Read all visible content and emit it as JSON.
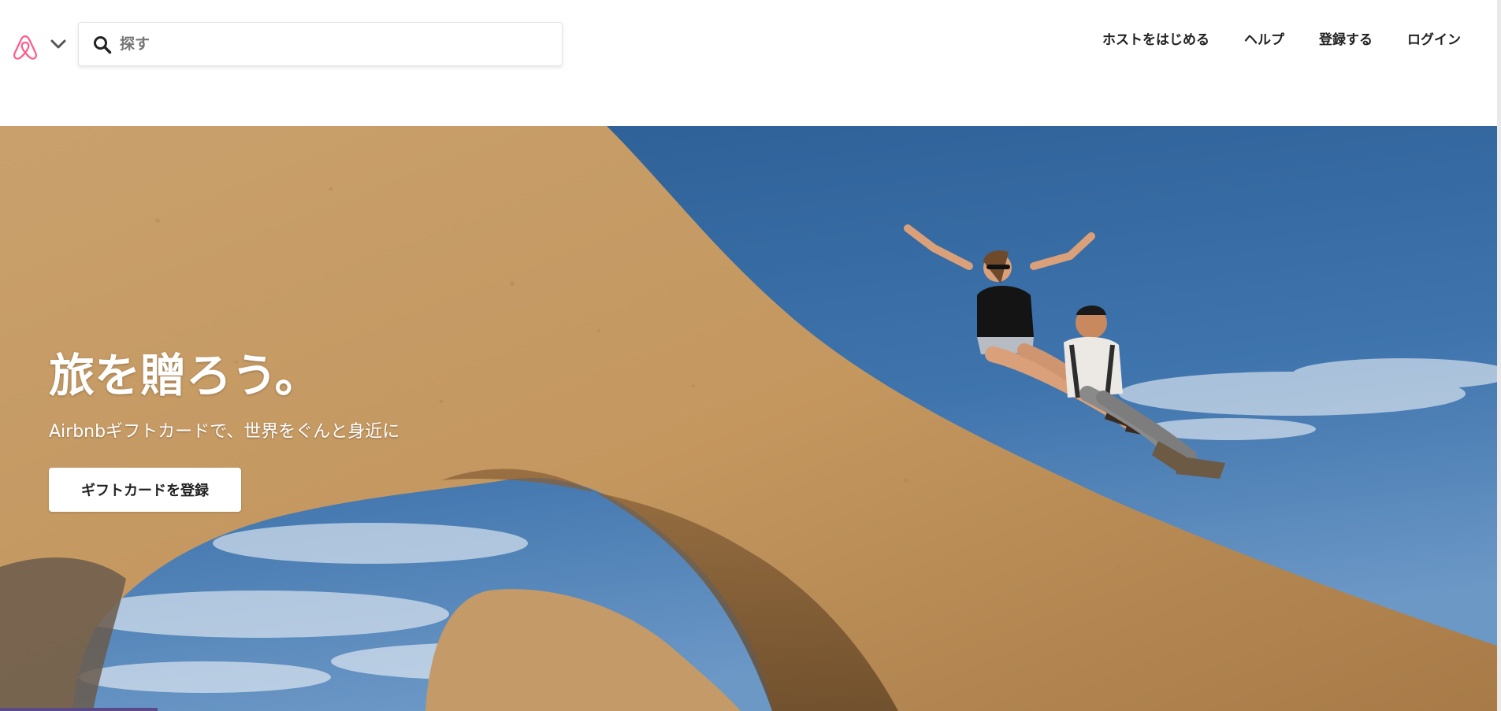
{
  "header": {
    "search": {
      "placeholder": "探す",
      "value": ""
    },
    "nav": [
      {
        "label": "ホストをはじめる"
      },
      {
        "label": "ヘルプ"
      },
      {
        "label": "登録する"
      },
      {
        "label": "ログイン"
      }
    ]
  },
  "hero": {
    "title": "旅を贈ろう。",
    "subtitle": "Airbnbギフトカードで、世界をぐんと身近に",
    "button_label": "ギフトカードを登録"
  },
  "colors": {
    "brand": "#FF5A5F",
    "logo": "#FF5A8A",
    "sky": "#3a6ea8",
    "rock": "#c69a62",
    "accent_bar": "#5a4a8a"
  }
}
